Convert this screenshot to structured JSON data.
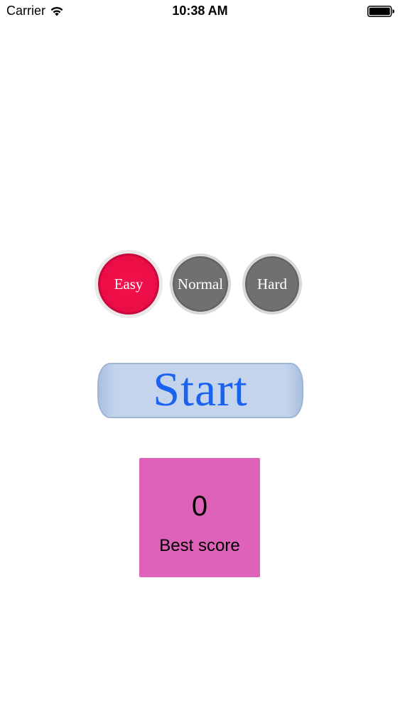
{
  "status_bar": {
    "carrier": "Carrier",
    "time": "10:38 AM",
    "wifi_icon": "wifi-icon",
    "battery_icon": "battery-icon"
  },
  "difficulty": {
    "selected": "Easy",
    "options": [
      {
        "label": "Easy",
        "color": "#ea0c45",
        "selected": true
      },
      {
        "label": "Normal",
        "color": "#707070",
        "selected": false
      },
      {
        "label": "Hard",
        "color": "#707070",
        "selected": false
      }
    ]
  },
  "start_button": {
    "label": "Start",
    "text_color": "#1a63f0",
    "background_color": "#c3d4ec"
  },
  "best_score": {
    "value": "0",
    "label": "Best score",
    "background_color": "#de63b8"
  }
}
